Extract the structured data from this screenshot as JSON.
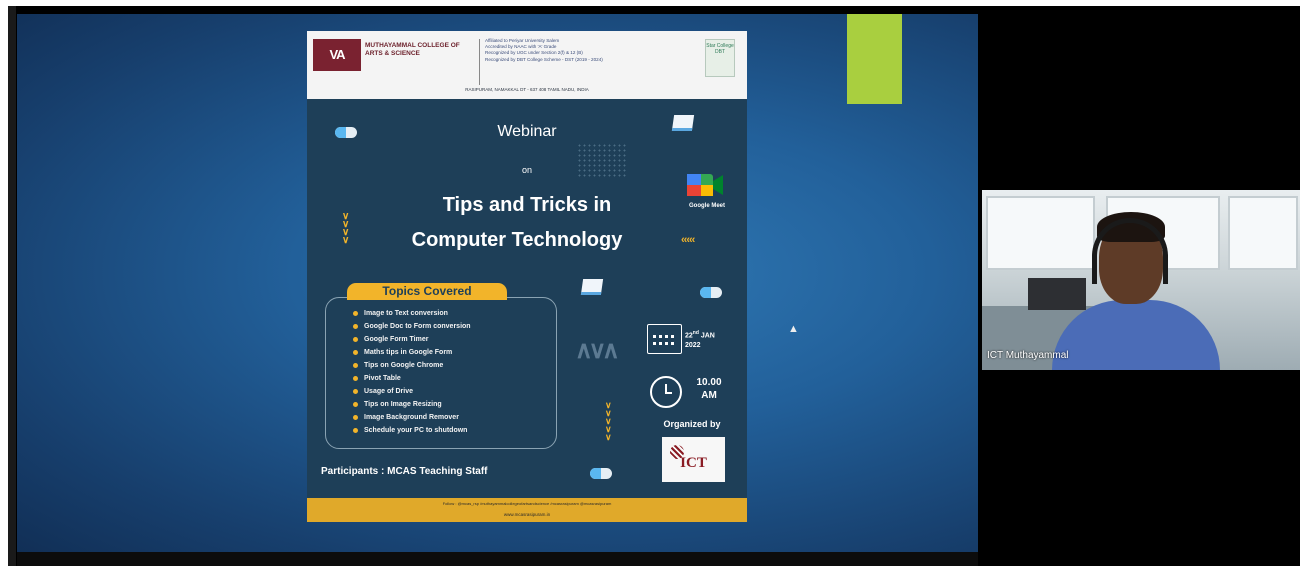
{
  "video_call": {
    "participant_name": "ICT Muthayammal"
  },
  "poster": {
    "logo_text": "VA",
    "college_name": "MUTHAYAMMAL COLLEGE OF ARTS & SCIENCE",
    "affiliation_lines": [
      "Affiliated to Periyar University Salem",
      "Accredited by NAAC with 'A' Grade",
      "Recognized by UGC under Section 2(f) & 12 (B)",
      "Recognized by DBT College Scheme - DST (2019 - 2024)"
    ],
    "badge_text": "Star College DBT",
    "address": "RASIPURAM, NAMAKKAL DT - 637 408 TAMIL NADU, INDIA",
    "heading_webinar": "Webinar",
    "heading_on": "on",
    "title_line1": "Tips and Tricks in",
    "title_line2": "Computer Technology",
    "platform_label": "Google Meet",
    "topics_heading": "Topics Covered",
    "topics": [
      "Image to Text conversion",
      "Google Doc to Form conversion",
      "Google Form Timer",
      "Maths tips in Google Form",
      "Tips on Google Chrome",
      "Pivot Table",
      "Usage of Drive",
      "Tips on Image Resizing",
      "Image Background Remover",
      "Schedule your PC to shutdown"
    ],
    "date_line1": "22",
    "date_sup": "nd",
    "date_month": "JAN",
    "date_year": "2022",
    "time_line1": "10.00",
    "time_line2": "AM",
    "organized_by": "Organized by",
    "organizer_logo": "ICT",
    "participants": "Participants : MCAS Teaching Staff",
    "footer_social": "Follow : @mcas_rsp  /muthayammalcollegeofartsandscience  /mcasrasipuram  @mcasrasipuram",
    "footer_url": "www.mcasrasipuram.in"
  },
  "colors": {
    "poster_background": "#1e3f58",
    "accent_yellow": "#f2b42a",
    "slide_background": "#22609a",
    "green_block": "#a9cf3f"
  }
}
